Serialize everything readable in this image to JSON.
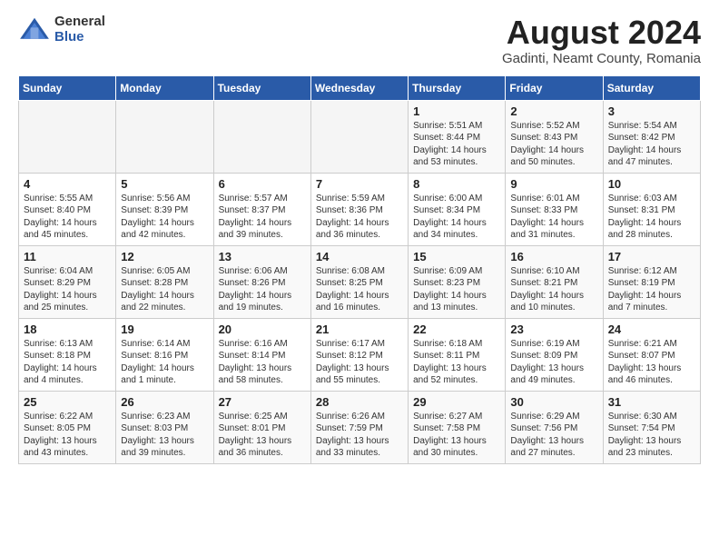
{
  "logo": {
    "general": "General",
    "blue": "Blue"
  },
  "title": "August 2024",
  "subtitle": "Gadinti, Neamt County, Romania",
  "weekdays": [
    "Sunday",
    "Monday",
    "Tuesday",
    "Wednesday",
    "Thursday",
    "Friday",
    "Saturday"
  ],
  "weeks": [
    [
      {
        "day": "",
        "info": ""
      },
      {
        "day": "",
        "info": ""
      },
      {
        "day": "",
        "info": ""
      },
      {
        "day": "",
        "info": ""
      },
      {
        "day": "1",
        "info": "Sunrise: 5:51 AM\nSunset: 8:44 PM\nDaylight: 14 hours\nand 53 minutes."
      },
      {
        "day": "2",
        "info": "Sunrise: 5:52 AM\nSunset: 8:43 PM\nDaylight: 14 hours\nand 50 minutes."
      },
      {
        "day": "3",
        "info": "Sunrise: 5:54 AM\nSunset: 8:42 PM\nDaylight: 14 hours\nand 47 minutes."
      }
    ],
    [
      {
        "day": "4",
        "info": "Sunrise: 5:55 AM\nSunset: 8:40 PM\nDaylight: 14 hours\nand 45 minutes."
      },
      {
        "day": "5",
        "info": "Sunrise: 5:56 AM\nSunset: 8:39 PM\nDaylight: 14 hours\nand 42 minutes."
      },
      {
        "day": "6",
        "info": "Sunrise: 5:57 AM\nSunset: 8:37 PM\nDaylight: 14 hours\nand 39 minutes."
      },
      {
        "day": "7",
        "info": "Sunrise: 5:59 AM\nSunset: 8:36 PM\nDaylight: 14 hours\nand 36 minutes."
      },
      {
        "day": "8",
        "info": "Sunrise: 6:00 AM\nSunset: 8:34 PM\nDaylight: 14 hours\nand 34 minutes."
      },
      {
        "day": "9",
        "info": "Sunrise: 6:01 AM\nSunset: 8:33 PM\nDaylight: 14 hours\nand 31 minutes."
      },
      {
        "day": "10",
        "info": "Sunrise: 6:03 AM\nSunset: 8:31 PM\nDaylight: 14 hours\nand 28 minutes."
      }
    ],
    [
      {
        "day": "11",
        "info": "Sunrise: 6:04 AM\nSunset: 8:29 PM\nDaylight: 14 hours\nand 25 minutes."
      },
      {
        "day": "12",
        "info": "Sunrise: 6:05 AM\nSunset: 8:28 PM\nDaylight: 14 hours\nand 22 minutes."
      },
      {
        "day": "13",
        "info": "Sunrise: 6:06 AM\nSunset: 8:26 PM\nDaylight: 14 hours\nand 19 minutes."
      },
      {
        "day": "14",
        "info": "Sunrise: 6:08 AM\nSunset: 8:25 PM\nDaylight: 14 hours\nand 16 minutes."
      },
      {
        "day": "15",
        "info": "Sunrise: 6:09 AM\nSunset: 8:23 PM\nDaylight: 14 hours\nand 13 minutes."
      },
      {
        "day": "16",
        "info": "Sunrise: 6:10 AM\nSunset: 8:21 PM\nDaylight: 14 hours\nand 10 minutes."
      },
      {
        "day": "17",
        "info": "Sunrise: 6:12 AM\nSunset: 8:19 PM\nDaylight: 14 hours\nand 7 minutes."
      }
    ],
    [
      {
        "day": "18",
        "info": "Sunrise: 6:13 AM\nSunset: 8:18 PM\nDaylight: 14 hours\nand 4 minutes."
      },
      {
        "day": "19",
        "info": "Sunrise: 6:14 AM\nSunset: 8:16 PM\nDaylight: 14 hours\nand 1 minute."
      },
      {
        "day": "20",
        "info": "Sunrise: 6:16 AM\nSunset: 8:14 PM\nDaylight: 13 hours\nand 58 minutes."
      },
      {
        "day": "21",
        "info": "Sunrise: 6:17 AM\nSunset: 8:12 PM\nDaylight: 13 hours\nand 55 minutes."
      },
      {
        "day": "22",
        "info": "Sunrise: 6:18 AM\nSunset: 8:11 PM\nDaylight: 13 hours\nand 52 minutes."
      },
      {
        "day": "23",
        "info": "Sunrise: 6:19 AM\nSunset: 8:09 PM\nDaylight: 13 hours\nand 49 minutes."
      },
      {
        "day": "24",
        "info": "Sunrise: 6:21 AM\nSunset: 8:07 PM\nDaylight: 13 hours\nand 46 minutes."
      }
    ],
    [
      {
        "day": "25",
        "info": "Sunrise: 6:22 AM\nSunset: 8:05 PM\nDaylight: 13 hours\nand 43 minutes."
      },
      {
        "day": "26",
        "info": "Sunrise: 6:23 AM\nSunset: 8:03 PM\nDaylight: 13 hours\nand 39 minutes."
      },
      {
        "day": "27",
        "info": "Sunrise: 6:25 AM\nSunset: 8:01 PM\nDaylight: 13 hours\nand 36 minutes."
      },
      {
        "day": "28",
        "info": "Sunrise: 6:26 AM\nSunset: 7:59 PM\nDaylight: 13 hours\nand 33 minutes."
      },
      {
        "day": "29",
        "info": "Sunrise: 6:27 AM\nSunset: 7:58 PM\nDaylight: 13 hours\nand 30 minutes."
      },
      {
        "day": "30",
        "info": "Sunrise: 6:29 AM\nSunset: 7:56 PM\nDaylight: 13 hours\nand 27 minutes."
      },
      {
        "day": "31",
        "info": "Sunrise: 6:30 AM\nSunset: 7:54 PM\nDaylight: 13 hours\nand 23 minutes."
      }
    ]
  ]
}
